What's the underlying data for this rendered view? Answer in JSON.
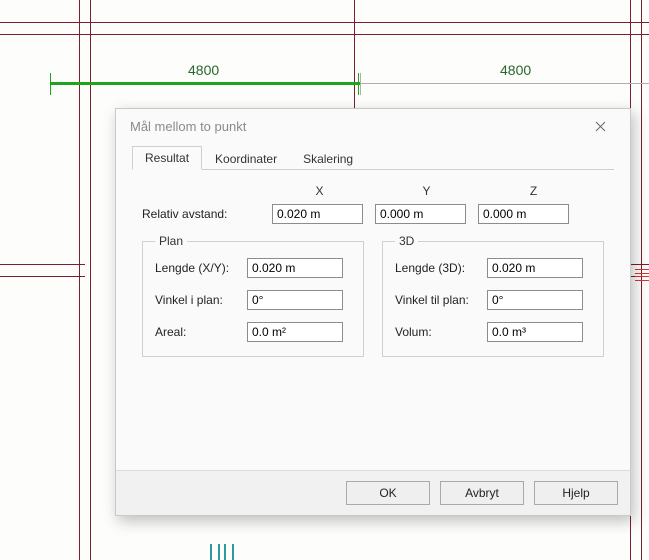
{
  "cad": {
    "dim1": "4800",
    "dim2": "4800"
  },
  "dialog": {
    "title": "Mål mellom to punkt",
    "tabs": {
      "resultat": "Resultat",
      "koordinater": "Koordinater",
      "skalering": "Skalering"
    },
    "columns": {
      "x": "X",
      "y": "Y",
      "z": "Z"
    },
    "relative": {
      "label": "Relativ avstand:",
      "x": "0.020 m",
      "y": "0.000 m",
      "z": "0.000 m"
    },
    "plan": {
      "legend": "Plan",
      "length_label": "Lengde (X/Y):",
      "length": "0.020 m",
      "angle_label": "Vinkel i plan:",
      "angle": "0°",
      "area_label": "Areal:",
      "area": "0.0 m²"
    },
    "three_d": {
      "legend": "3D",
      "length_label": "Lengde (3D):",
      "length": "0.020 m",
      "angle_label": "Vinkel til plan:",
      "angle": "0°",
      "volume_label": "Volum:",
      "volume": "0.0 m³"
    },
    "buttons": {
      "ok": "OK",
      "cancel": "Avbryt",
      "help": "Hjelp"
    }
  }
}
